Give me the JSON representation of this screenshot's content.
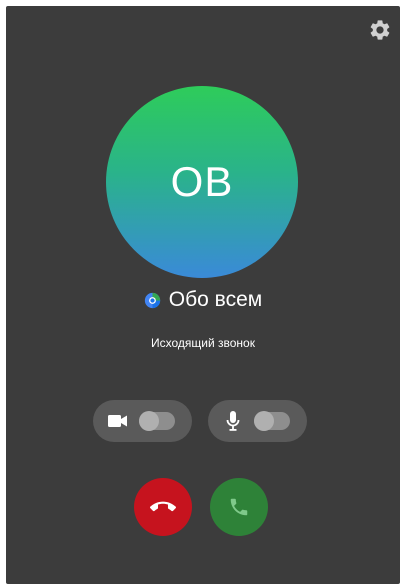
{
  "contact": {
    "initials": "OB",
    "name": "Обо всем"
  },
  "call": {
    "status": "Исходящий звонок"
  },
  "controls": {
    "video_toggle": {
      "icon": "video-camera-icon",
      "state": "off"
    },
    "mic_toggle": {
      "icon": "microphone-icon",
      "state": "off"
    },
    "end_call": {
      "icon": "phone-hangup-icon",
      "color": "#c6131e"
    },
    "accept_call": {
      "icon": "phone-icon",
      "color": "#2e8238"
    }
  },
  "header": {
    "settings_icon": "gear-icon"
  },
  "colors": {
    "background": "#3c3c3c",
    "avatar_gradient_top": "#2ecc5a",
    "avatar_gradient_bottom": "#3a8ad8",
    "pill": "#5a5a5a"
  }
}
